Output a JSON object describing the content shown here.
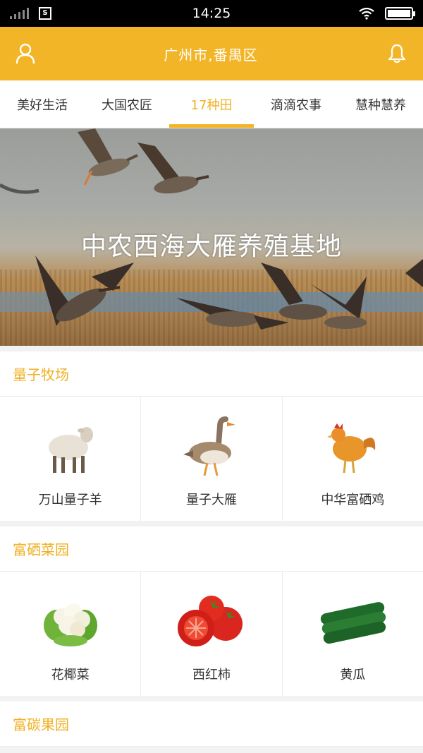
{
  "status_bar": {
    "time": "14:25",
    "sim_label": "S"
  },
  "header": {
    "location": "广州市,番禺区",
    "profile_icon": "user-icon",
    "notification_icon": "bell-icon"
  },
  "tabs": [
    {
      "label": "美好生活",
      "active": false
    },
    {
      "label": "大国农匠",
      "active": false
    },
    {
      "label": "17种田",
      "active": true
    },
    {
      "label": "滴滴农事",
      "active": false
    },
    {
      "label": "慧种慧养",
      "active": false
    }
  ],
  "banner": {
    "caption": "中农西海大雁养殖基地"
  },
  "sections": [
    {
      "title": "量子牧场",
      "items": [
        {
          "label": "万山量子羊"
        },
        {
          "label": "量子大雁"
        },
        {
          "label": "中华富硒鸡"
        }
      ]
    },
    {
      "title": "富硒菜园",
      "items": [
        {
          "label": "花椰菜"
        },
        {
          "label": "西红柿"
        },
        {
          "label": "黄瓜"
        }
      ]
    },
    {
      "title": "富碳果园",
      "items": []
    }
  ],
  "colors": {
    "accent": "#f3b528",
    "accent_text": "#f0b022"
  }
}
